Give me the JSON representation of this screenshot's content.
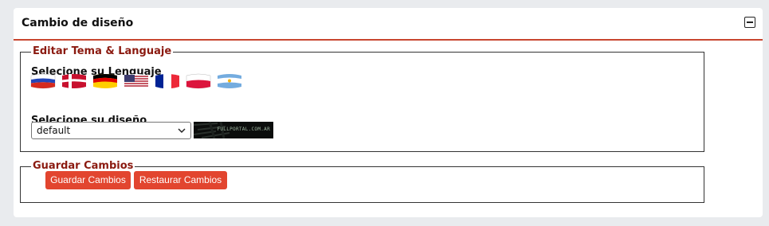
{
  "panel": {
    "title": "Cambio de diseño",
    "collapse_icon": "minus-square-icon"
  },
  "theme_section": {
    "legend": "Editar Tema & Languaje",
    "language_label": "Selecione su Lenguaje",
    "languages": [
      {
        "name": "Russian",
        "icon": "flag-russia-icon"
      },
      {
        "name": "Danish",
        "icon": "flag-denmark-icon"
      },
      {
        "name": "German",
        "icon": "flag-germany-icon"
      },
      {
        "name": "English",
        "icon": "flag-usa-icon"
      },
      {
        "name": "French",
        "icon": "flag-france-icon"
      },
      {
        "name": "Polish",
        "icon": "flag-poland-icon"
      },
      {
        "name": "Spanish (Argentina)",
        "icon": "flag-argentina-icon"
      }
    ],
    "design_label": "Selecione su diseño",
    "design_select_value": "default",
    "preview_text": "FULLPORTAL.COM.AR"
  },
  "save_section": {
    "legend": "Guardar Cambios",
    "save_button": "Guardar Cambios",
    "restore_button": "Restaurar Cambios"
  },
  "colors": {
    "accent": "#e2452f",
    "legend": "#8b1a10",
    "page_bg": "#e9ebee"
  }
}
